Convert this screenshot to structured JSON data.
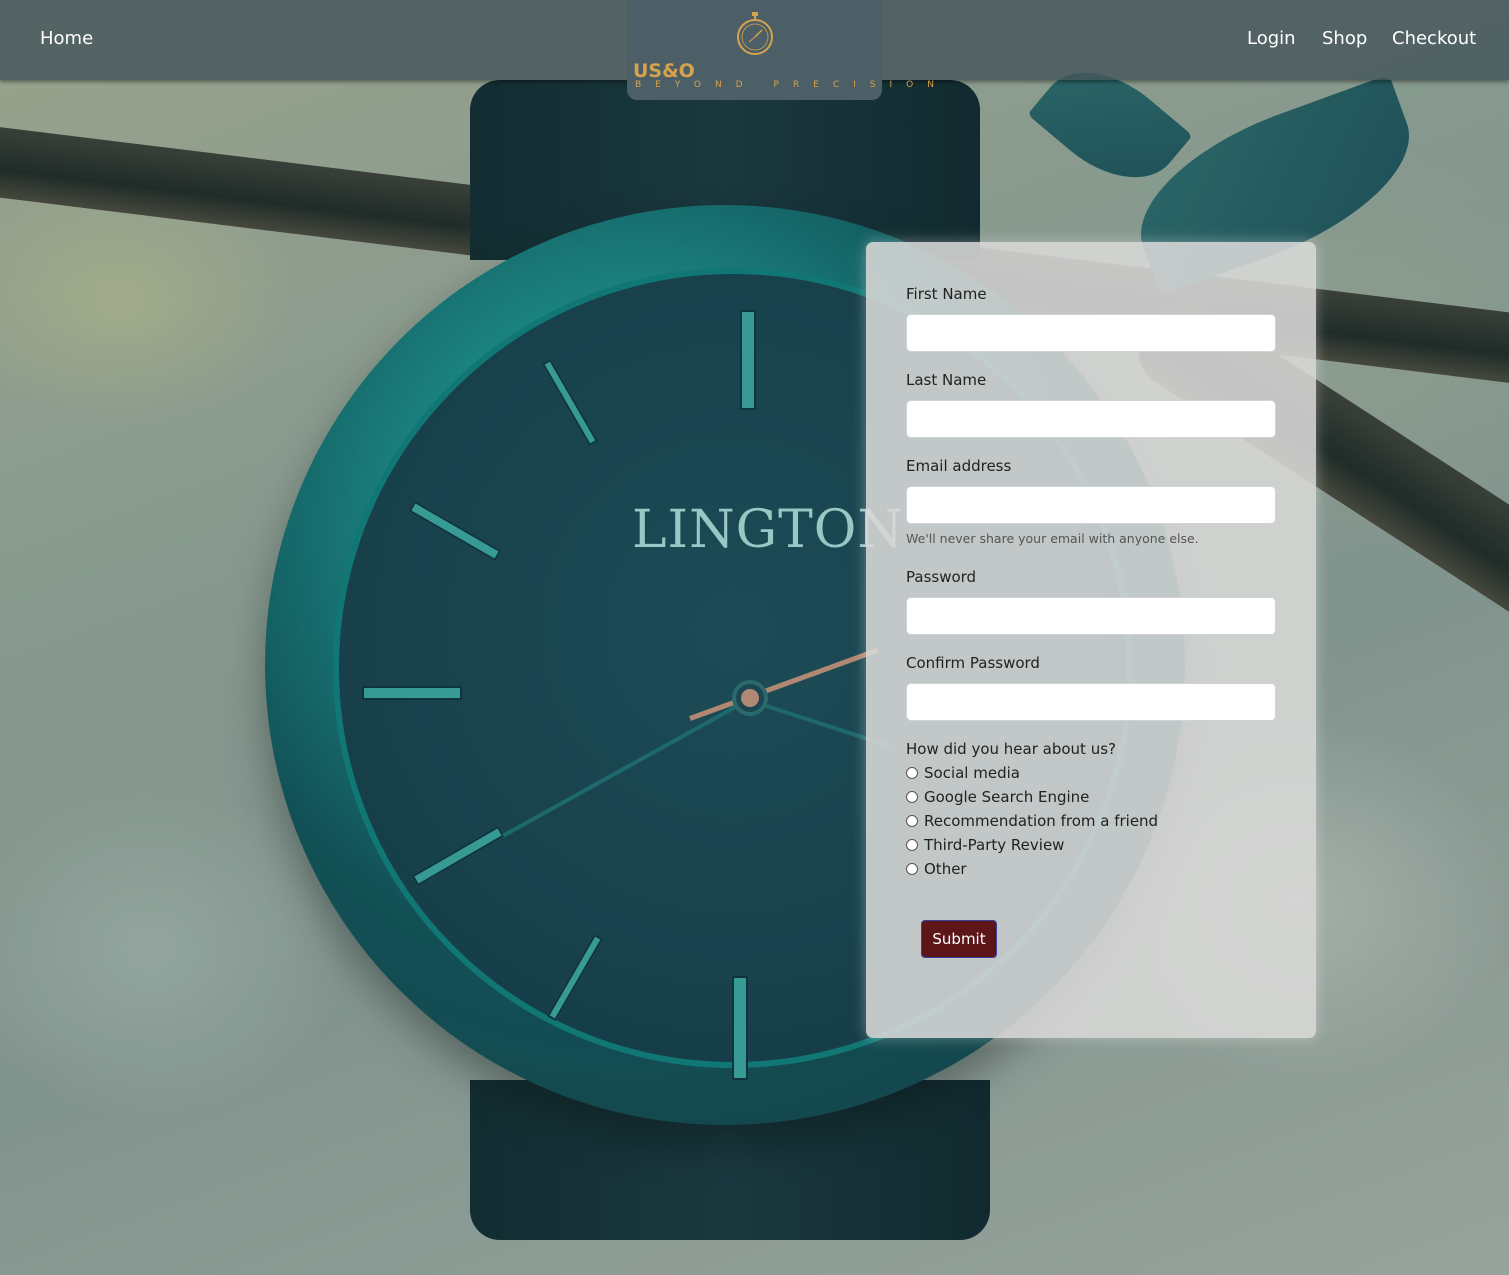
{
  "nav": {
    "home": "Home",
    "login": "Login",
    "shop": "Shop",
    "checkout": "Checkout"
  },
  "logo": {
    "wordmark": "US&O",
    "tagline": "BEYOND PRECISION",
    "icon": "stopwatch-icon",
    "color": "#d6a24c"
  },
  "background": {
    "watch_face_text": "LINGTON"
  },
  "form": {
    "first_name_label": "First Name",
    "last_name_label": "Last Name",
    "email_label": "Email address",
    "email_help": "We'll never share your email with anyone else.",
    "password_label": "Password",
    "confirm_password_label": "Confirm Password",
    "first_name_value": "",
    "last_name_value": "",
    "email_value": "",
    "password_value": "",
    "confirm_password_value": "",
    "heard_question": "How did you hear about us?",
    "options": [
      "Social media",
      "Google Search Engine",
      "Recommendation from a friend",
      "Third-Party Review",
      "Other"
    ],
    "submit_label": "Submit",
    "submit_color": "#5c1618"
  }
}
